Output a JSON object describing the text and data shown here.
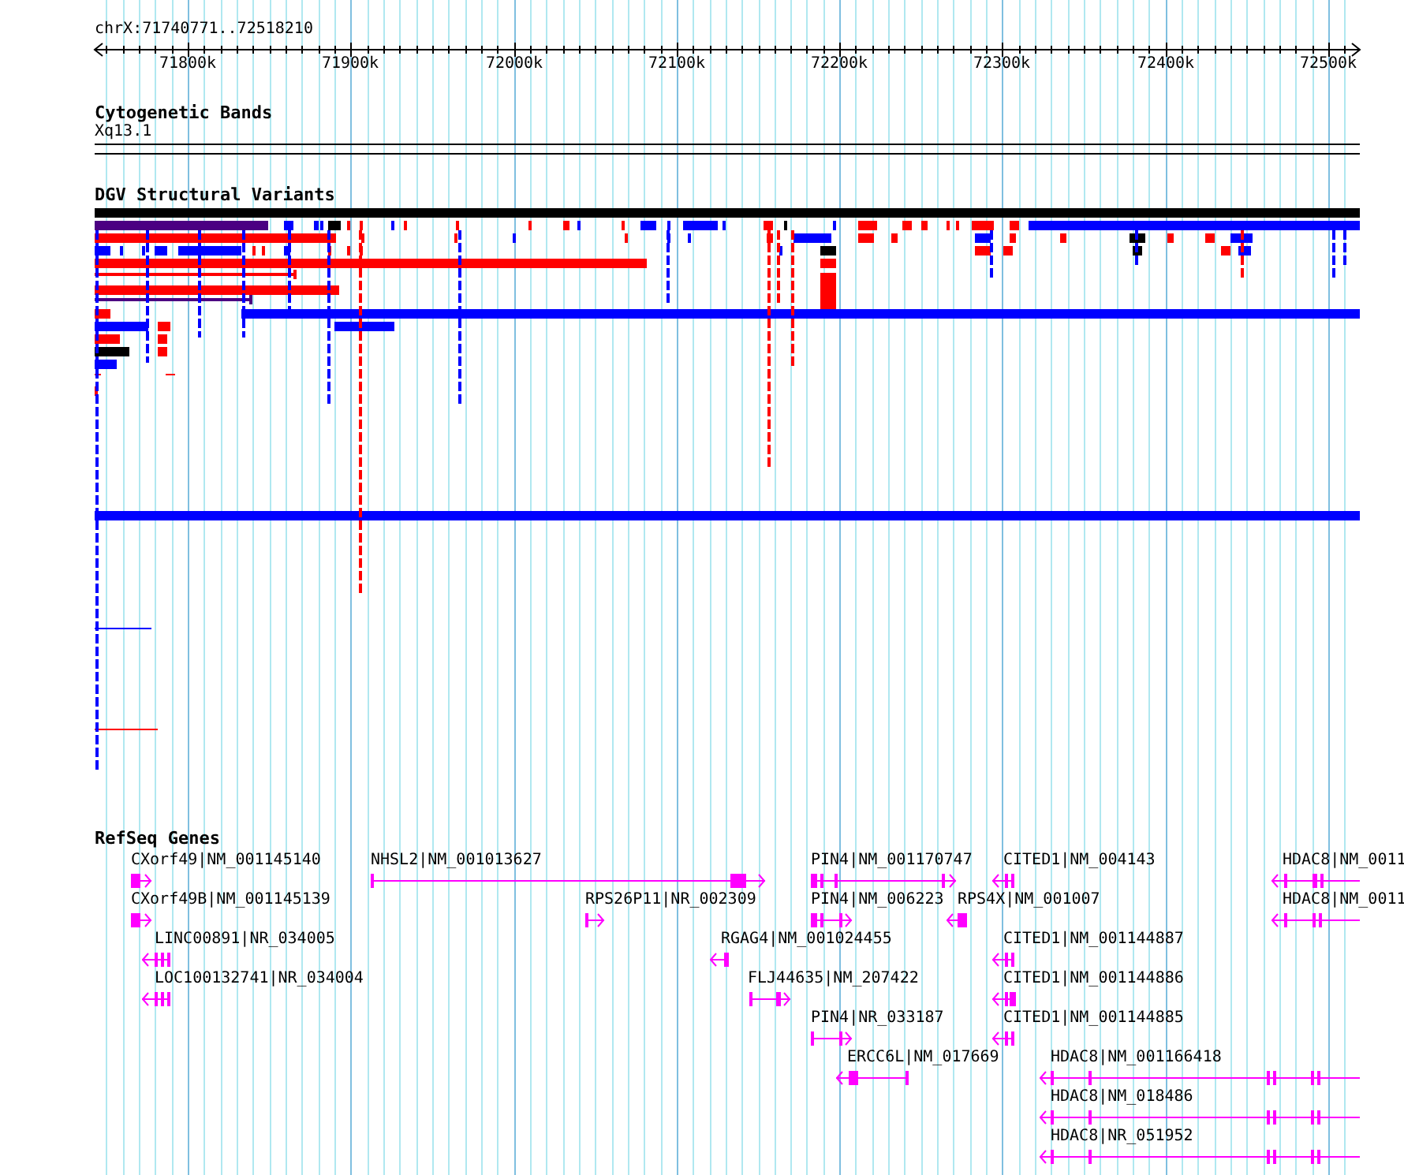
{
  "ruler": {
    "location": "chrX:71740771..72518210",
    "ticks": [
      "71800k",
      "71900k",
      "72000k",
      "72100k",
      "72200k",
      "72300k",
      "72400k",
      "72500k"
    ]
  },
  "tracks": [
    {
      "kind": "cytoband",
      "title": "Cytogenetic Bands",
      "band": "Xq13.1"
    },
    {
      "kind": "variants",
      "title": "DGV Structural Variants"
    },
    {
      "kind": "genes",
      "title": "RefSeq Genes",
      "genes": [
        {
          "label": "CXorf49|NM_001145140",
          "reverse": false
        },
        {
          "label": "NHSL2|NM_001013627",
          "reverse": false
        },
        {
          "label": "PIN4|NM_001170747",
          "reverse": false
        },
        {
          "label": "CITED1|NM_004143",
          "reverse": true
        },
        {
          "label": "HDAC8|NM_0011",
          "reverse": true
        },
        {
          "label": "CXorf49B|NM_001145139",
          "reverse": false
        },
        {
          "label": "RPS26P11|NR_002309",
          "reverse": false
        },
        {
          "label": "PIN4|NM_006223",
          "reverse": false
        },
        {
          "label": "RPS4X|NM_001007",
          "reverse": true
        },
        {
          "label": "HDAC8|NM_0011",
          "reverse": true
        },
        {
          "label": "LINC00891|NR_034005",
          "reverse": true
        },
        {
          "label": "RGAG4|NM_001024455",
          "reverse": true
        },
        {
          "label": "CITED1|NM_001144887",
          "reverse": true
        },
        {
          "label": "LOC100132741|NR_034004",
          "reverse": true
        },
        {
          "label": "FLJ44635|NM_207422",
          "reverse": false
        },
        {
          "label": "CITED1|NM_001144886",
          "reverse": true
        },
        {
          "label": "PIN4|NR_033187",
          "reverse": false
        },
        {
          "label": "CITED1|NM_001144885",
          "reverse": true
        },
        {
          "label": "ERCC6L|NM_017669",
          "reverse": true
        },
        {
          "label": "HDAC8|NM_001166418",
          "reverse": true
        },
        {
          "label": "HDAC8|NM_018486",
          "reverse": true
        },
        {
          "label": "HDAC8|NR_051952",
          "reverse": true
        }
      ]
    }
  ]
}
